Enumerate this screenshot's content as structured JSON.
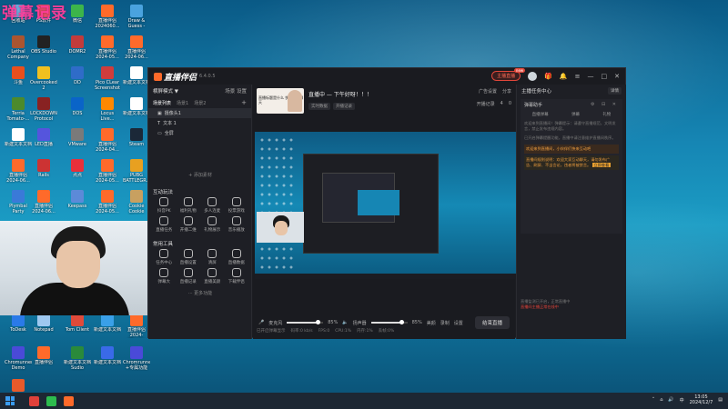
{
  "overlay": {
    "text": "弹幕记录"
  },
  "desktop_icons": [
    {
      "label": "回收站",
      "color": "#6fa8dc"
    },
    {
      "label": "PS软件",
      "color": "#e84a6a"
    },
    {
      "label": "微信",
      "color": "#3cb54a"
    },
    {
      "label": "直播伴侣 2024060...",
      "color": "#ff6a2a"
    },
    {
      "label": "Draw & Guess - Gu...",
      "color": "#4aa3df"
    },
    {
      "label": "Lethal Company",
      "color": "#aa5530"
    },
    {
      "label": "OBS Studio",
      "color": "#222222"
    },
    {
      "label": "DOMR2",
      "color": "#c23b3b"
    },
    {
      "label": "直播伴侣 2024-05...",
      "color": "#ff6a2a"
    },
    {
      "label": "直播伴侣 2024-06...",
      "color": "#ff6a2a"
    },
    {
      "label": "斗鱼",
      "color": "#e94f1d"
    },
    {
      "label": "Overcooked! 2",
      "color": "#f0c020"
    },
    {
      "label": "DD",
      "color": "#2f6cc8"
    },
    {
      "label": "Pico CLear Screenshot",
      "color": "#d03c3c"
    },
    {
      "label": "新建文本文档",
      "color": "#ffffff"
    },
    {
      "label": "Terria Tomato-...",
      "color": "#4c8a2c"
    },
    {
      "label": "LOCKDOWN Protocol",
      "color": "#882222"
    },
    {
      "label": "DOS",
      "color": "#0a64c8"
    },
    {
      "label": "Locus Live...",
      "color": "#ff8800"
    },
    {
      "label": "新建文本文档",
      "color": "#ffffff"
    },
    {
      "label": "新建文本文档",
      "color": "#ffffff"
    },
    {
      "label": "LED直播",
      "color": "#5555dd"
    },
    {
      "label": "VMware",
      "color": "#7a7a7a"
    },
    {
      "label": "直播伴侣 2024-04...",
      "color": "#ff6a2a"
    },
    {
      "label": "Steam",
      "color": "#1b2838"
    },
    {
      "label": "直播伴侣 2024-06...",
      "color": "#ff6a2a"
    },
    {
      "label": "Rails",
      "color": "#cc3333"
    },
    {
      "label": "点点",
      "color": "#e8303a"
    },
    {
      "label": "直播伴侣 2024-05...",
      "color": "#ff6a2a"
    },
    {
      "label": "PUBG BATTLEGR...",
      "color": "#e8a020"
    },
    {
      "label": "Plymbal Party",
      "color": "#3a7ad8"
    },
    {
      "label": "直播伴侣 2024-06...",
      "color": "#ff6a2a"
    },
    {
      "label": "Keepass",
      "color": "#5c8ad8"
    },
    {
      "label": "直播伴侣 2024-05...",
      "color": "#ff6a2a"
    },
    {
      "label": "Cookie Cookie Clicker",
      "color": "#c8a060"
    },
    {
      "label": "ToDesk",
      "color": "#2a7ae8"
    },
    {
      "label": "Notepad",
      "color": "#9ec8f0"
    },
    {
      "label": "Tom Client",
      "color": "#e04a3a"
    },
    {
      "label": "新建文本文档",
      "color": "#3aa0e8"
    },
    {
      "label": "直播伴侣 2024-05...dic",
      "color": "#ff6a2a"
    },
    {
      "label": "Chromunner Demo",
      "color": "#4a4ad8"
    },
    {
      "label": "直播伴侣",
      "color": "#ff6a2a"
    },
    {
      "label": "新建文本文档 Sudio",
      "color": "#2a8a3a"
    },
    {
      "label": "新建文本文档",
      "color": "#3a6ae8"
    },
    {
      "label": "Chromrunner +专属功能",
      "color": "#4a4ad8"
    },
    {
      "label": "直播",
      "color": "#e85a2a"
    }
  ],
  "app": {
    "logo": "直播伴侣",
    "version": "6.4.0.5",
    "go_live_badge": "主播直播",
    "badge_tag": "new",
    "window_controls": [
      "—",
      "□",
      "✕"
    ]
  },
  "scenes": {
    "header": "横屏模式 ▼",
    "header_right": "场景 设置",
    "tabs": [
      "场景列表",
      "场景1",
      "场景2"
    ],
    "sources": [
      {
        "label": "摄像头1",
        "selected": true
      },
      {
        "label": "文本 1",
        "selected": false
      },
      {
        "label": "全屏",
        "selected": false
      }
    ],
    "add_source": "+ 添加素材"
  },
  "interaction": {
    "title": "互动玩法",
    "items": [
      "抖音PK",
      "福利礼物",
      "多人连麦",
      "投票游戏",
      "直播任务",
      "开播二维",
      "礼物展示",
      "音乐播放"
    ]
  },
  "tools": {
    "title": "常用工具",
    "items": [
      "任务中心",
      "直播设置",
      "清屏",
      "直播数据",
      "弹幕大",
      "直播记录",
      "直播美颜",
      "下载伴侣"
    ],
    "more": "··· 更多功能"
  },
  "room": {
    "thumb_text": "直播标题是什么 快来和我聊天",
    "title": "直播中 — 下午好呀！！！",
    "tags": [
      "实时数据",
      "开播记录"
    ],
    "actions_row1": [
      "广告设置",
      "分享"
    ],
    "actions_row2": [
      "开播记录",
      "4",
      "0"
    ]
  },
  "audio": {
    "mic_label": "麦克风",
    "mic_pct": "85%",
    "mic_level": 0.85,
    "speaker_label": "扬声器",
    "speaker_pct": "85%",
    "speaker_level": 0.85,
    "icons": [
      "美颜",
      "录制",
      "设置"
    ],
    "go_live": "结束直播"
  },
  "status": {
    "items": [
      "已开启弹幕显示",
      "码率:0 kb/s",
      "FPS:0",
      "CPU:1%",
      "内存:1%",
      "丢帧:0%"
    ]
  },
  "right_panel": {
    "header": "主播任务中心",
    "header_btn": "详情",
    "panel_title": "弹幕助手",
    "tabs": [
      "直播弹幕",
      "弹幕",
      "礼物"
    ],
    "msg1": "欢迎来到直播间！弹幕提示：请遵守直播规范，文明发言，禁止发布违规内容。",
    "msg2": "已开启弹幕提醒功能，直播中请注意维护直播间秩序。",
    "highlight1": "欢迎来到直播间，小伙伴们快来互动吧",
    "highlight2": "直播间规则说明：欢迎大家互动聊天，请勿发布广告、刷屏、不当言论，违者将被禁言。",
    "highlight2_tag": "立即查看",
    "bottom_note": "直播监测已开启，正常直播中",
    "bottom_red": "直播间主播正常在线中"
  },
  "taskbar": {
    "time": "13:05",
    "date": "2024/12/7",
    "tray_lang": "中",
    "apps": [
      "WPS",
      "微信",
      "直播伴侣"
    ]
  }
}
